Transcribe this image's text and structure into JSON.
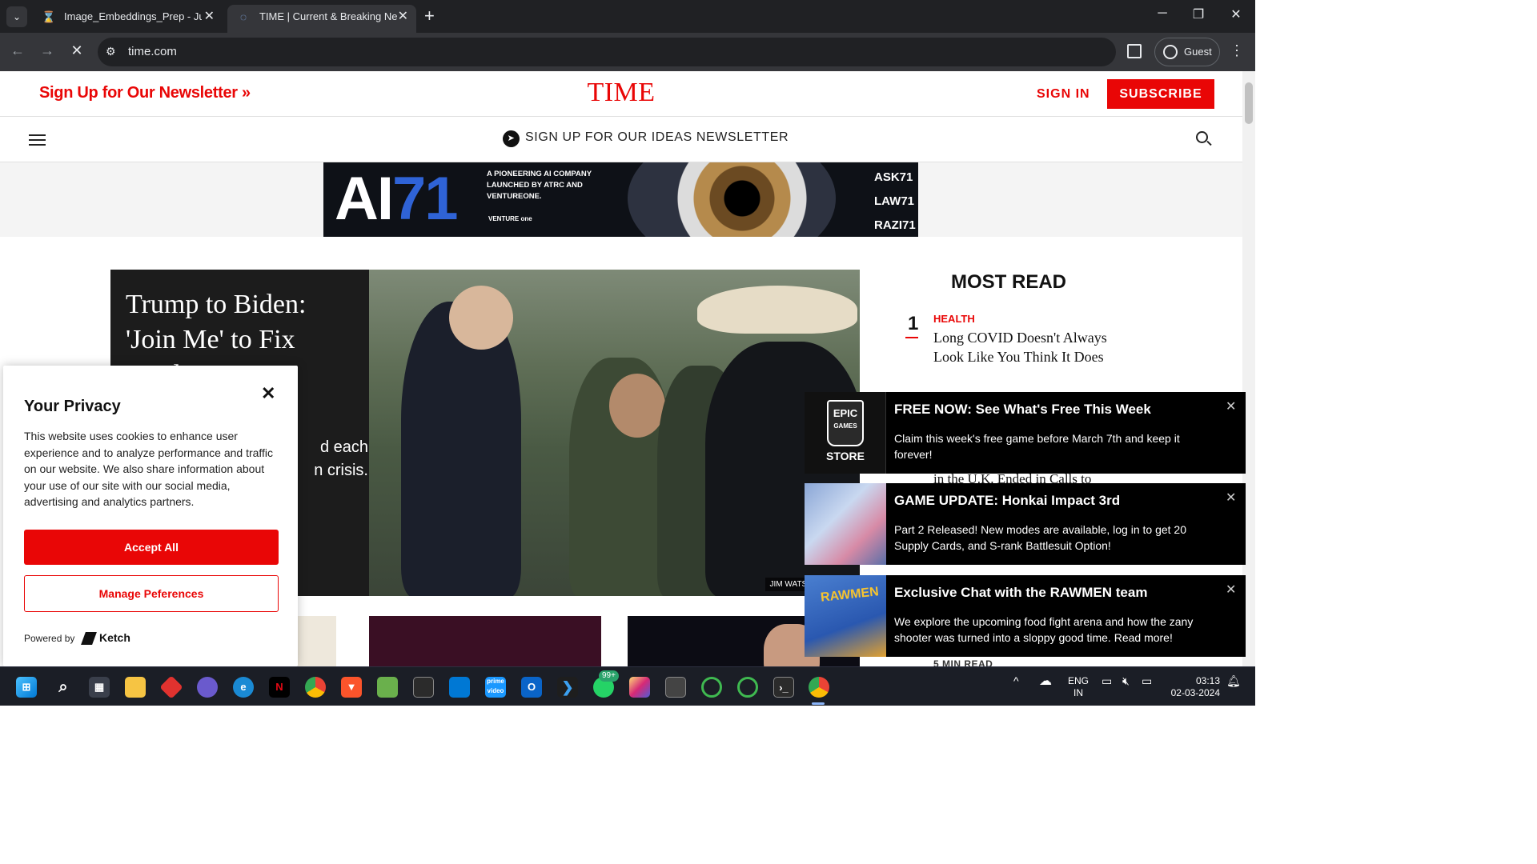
{
  "browser": {
    "tabs": [
      {
        "title": "Image_Embeddings_Prep - Jupy",
        "icon": "jupyter-hourglass-icon",
        "active": false
      },
      {
        "title": "TIME | Current & Breaking New",
        "icon": "loading-spinner-icon",
        "active": true
      }
    ],
    "new_tab": "+",
    "url": "time.com",
    "profile_label": "Guest"
  },
  "site": {
    "newsletter_link": "Sign Up for Our Newsletter »",
    "logo": "TIME",
    "signin": "SIGN IN",
    "subscribe": "SUBSCRIBE",
    "ideas_newsletter": "SIGN UP FOR OUR IDEAS NEWSLETTER"
  },
  "ad": {
    "brand_ai": "AI",
    "brand_71": "71",
    "tagline": "A PIONEERING AI COMPANY LAUNCHED BY ATRC AND VENTUREONE.",
    "venture": "VENTURE one",
    "products": [
      "ASK71",
      "LAW71",
      "RAZI71"
    ]
  },
  "hero": {
    "headline": "Trump to Biden: 'Join Me' to Fix Bord…",
    "dek_line1": "d each",
    "dek_line2": "n crisis.",
    "photo_credit": "JIM WATSON—AFP via"
  },
  "most_read": {
    "heading": "MOST READ",
    "items": [
      {
        "rank": "1",
        "category": "HEALTH",
        "title": "Long COVID Doesn't Always Look Like You Think It Does"
      }
    ],
    "partial_text": "in the U.K. Ended in Calls to",
    "read_time": "5 MIN READ"
  },
  "privacy": {
    "title": "Your Privacy",
    "body": "This website uses cookies to enhance user experience and to analyze performance and traffic on our website. We also share information about your use of our site with our social media, advertising and analytics partners.",
    "accept": "Accept All",
    "manage": "Manage Peferences",
    "powered_by": "Powered by",
    "vendor": "Ketch"
  },
  "notifications": [
    {
      "title": "FREE NOW: See What's Free This Week",
      "body": "Claim this week's free game before March 7th and keep it forever!",
      "thumb": "epic-games-store"
    },
    {
      "title": "GAME UPDATE: Honkai Impact 3rd",
      "body": "Part 2 Released! New modes are available, log in to get 20 Supply Cards, and S-rank Battlesuit Option!",
      "thumb": "honkai-impact"
    },
    {
      "title": "Exclusive Chat with the RAWMEN team",
      "body": "We explore the upcoming food fight arena and how the zany shooter was turned into a sloppy good time. Read more!",
      "thumb": "rawmen"
    }
  ],
  "epic_thumb": {
    "line1": "EPIC",
    "line2": "GAMES",
    "store": "STORE"
  },
  "rawmen_thumb": "RAWMEN",
  "taskbar": {
    "badge": "99+",
    "lang": "ENG",
    "region": "IN",
    "time": "03:13",
    "date": "02-03-2024"
  }
}
